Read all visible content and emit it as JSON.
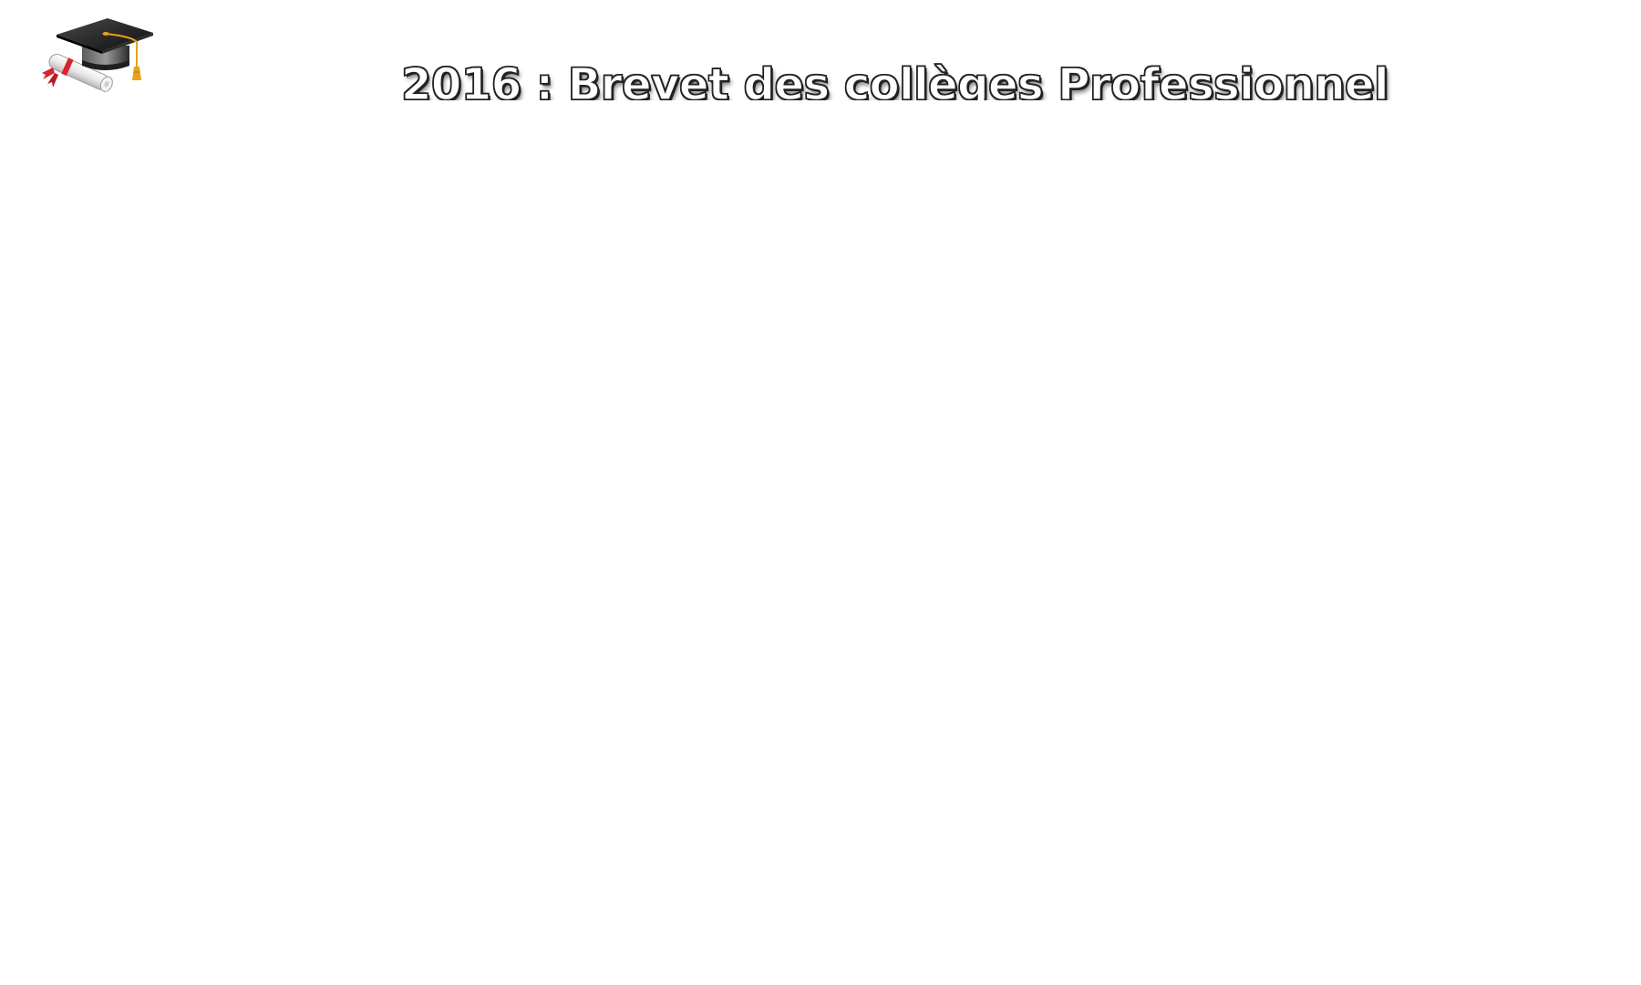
{
  "header": {
    "title": "2016 : Brevet des collèges Professionnel",
    "logo_icon": "graduation-cap-diploma-icon"
  },
  "colors": {
    "background": "#ffffff",
    "title_fill": "#ffffff",
    "title_outline": "#222222",
    "cap": "#1a1a1a",
    "tassel": "#e8a318",
    "ribbon": "#d9232e"
  }
}
